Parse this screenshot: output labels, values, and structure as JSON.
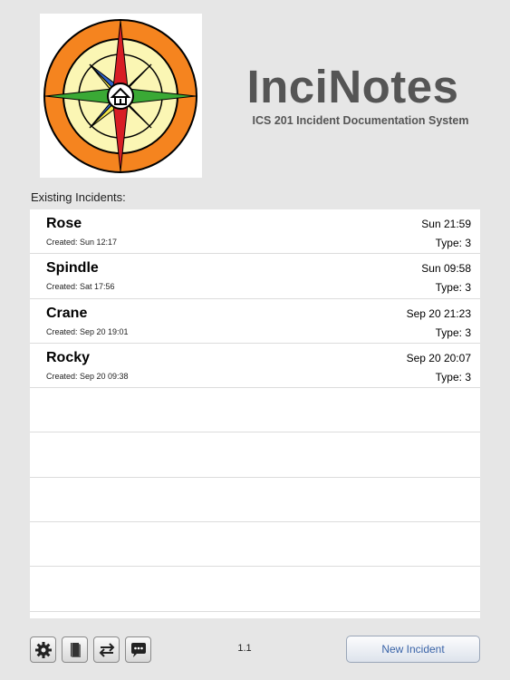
{
  "app": {
    "title": "InciNotes",
    "subtitle": "ICS 201 Incident Documentation System",
    "logo_icon": "compass-rose-logo"
  },
  "list_section": {
    "label": "Existing Incidents:",
    "incidents": [
      {
        "name": "Rose",
        "created": "Created:  Sun 12:17",
        "time": "Sun 21:59",
        "type": "Type: 3"
      },
      {
        "name": "Spindle",
        "created": "Created:  Sat 17:56",
        "time": "Sun 09:58",
        "type": "Type: 3"
      },
      {
        "name": "Crane",
        "created": "Created:  Sep 20 19:01",
        "time": "Sep 20 21:23",
        "type": "Type: 3"
      },
      {
        "name": "Rocky",
        "created": "Created:  Sep 20 09:38",
        "time": "Sep 20 20:07",
        "type": "Type: 3"
      }
    ]
  },
  "toolbar": {
    "icons": [
      "gear-icon",
      "book-icon",
      "swap-arrows-icon",
      "chat-bubble-icon"
    ],
    "version": "1.1",
    "new_incident_label": "New Incident"
  },
  "colors": {
    "background": "#e6e6e6",
    "title_gray": "#555555",
    "button_text_blue": "#3a64a8",
    "logo_orange": "#f5841f",
    "logo_yellow": "#fbf6b4",
    "logo_red": "#d81e25",
    "logo_green": "#3aa935",
    "logo_blue": "#2f62c9"
  }
}
